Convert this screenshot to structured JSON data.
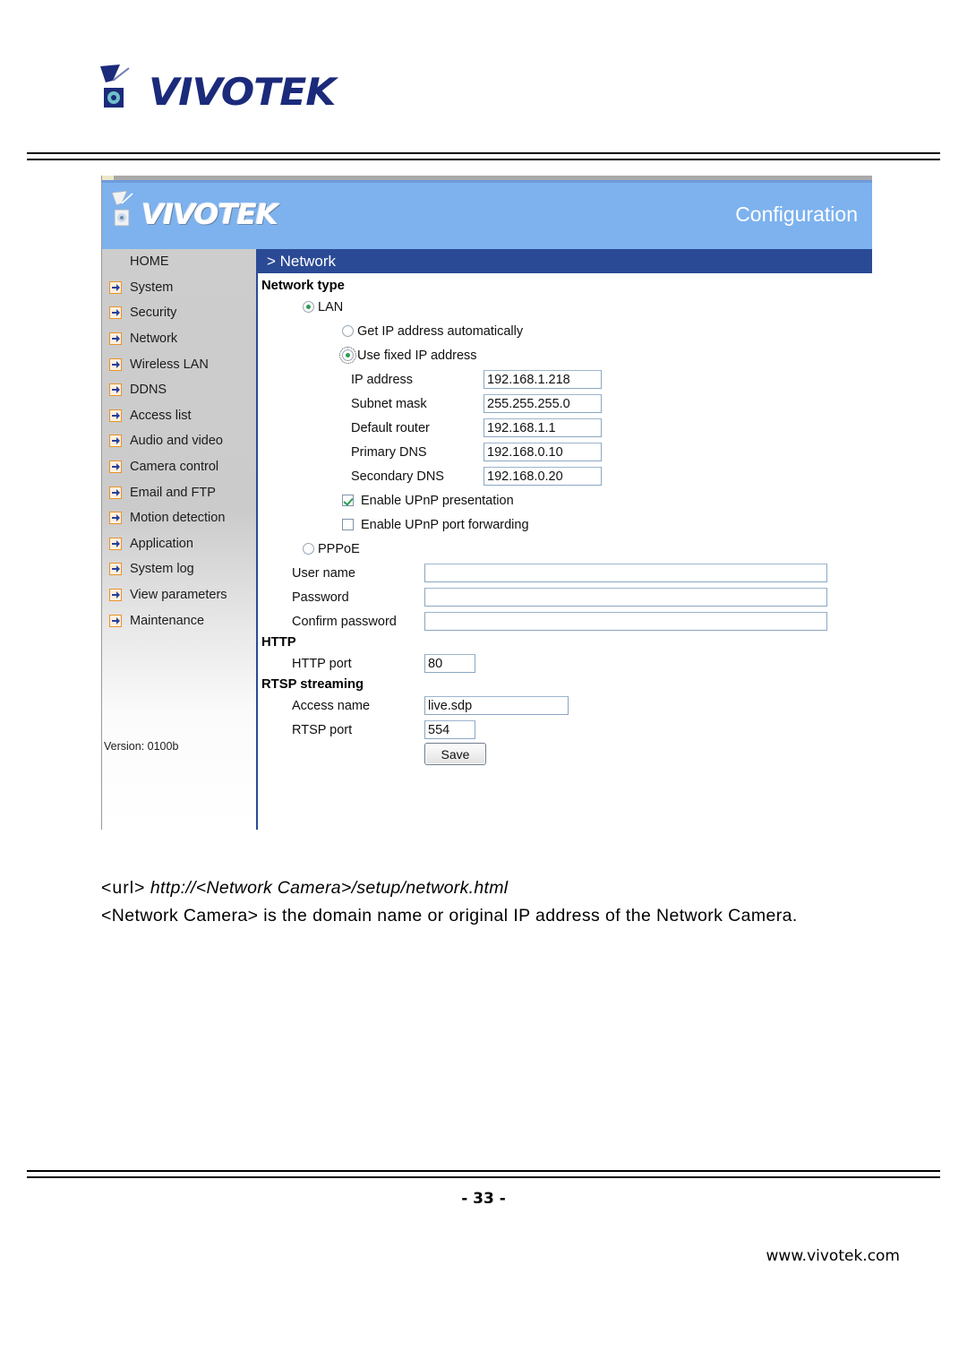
{
  "document": {
    "brand": "VIVOTEK",
    "page_number": "- 33 -",
    "website": "www.vivotek.com",
    "caption_url_tag": "<url>",
    "caption_url_value": "http://<Network Camera>/setup/network.html",
    "caption_note": "<Network Camera> is the domain name or original IP address of the Network Camera."
  },
  "screenshot": {
    "header": {
      "brand": "VIVOTEK",
      "section": "Configuration"
    },
    "breadcrumb": "> Network",
    "sidebar": {
      "items": [
        {
          "label": "HOME",
          "has_icon": false
        },
        {
          "label": "System",
          "has_icon": true
        },
        {
          "label": "Security",
          "has_icon": true
        },
        {
          "label": "Network",
          "has_icon": true
        },
        {
          "label": "Wireless LAN",
          "has_icon": true
        },
        {
          "label": "DDNS",
          "has_icon": true
        },
        {
          "label": "Access list",
          "has_icon": true
        },
        {
          "label": "Audio and video",
          "has_icon": true
        },
        {
          "label": "Camera control",
          "has_icon": true
        },
        {
          "label": "Email and FTP",
          "has_icon": true
        },
        {
          "label": "Motion detection",
          "has_icon": true
        },
        {
          "label": "Application",
          "has_icon": true
        },
        {
          "label": "System log",
          "has_icon": true
        },
        {
          "label": "View parameters",
          "has_icon": true
        },
        {
          "label": "Maintenance",
          "has_icon": true
        }
      ],
      "version": "Version: 0100b"
    },
    "form": {
      "network_type_heading": "Network type",
      "lan_label": "LAN",
      "lan_selected": true,
      "get_ip_auto_label": "Get IP address automatically",
      "get_ip_auto_selected": false,
      "use_fixed_label": "Use fixed IP address",
      "use_fixed_selected": true,
      "fields": [
        {
          "label": "IP address",
          "value": "192.168.1.218"
        },
        {
          "label": "Subnet mask",
          "value": "255.255.255.0"
        },
        {
          "label": "Default router",
          "value": "192.168.1.1"
        },
        {
          "label": "Primary DNS",
          "value": "192.168.0.10"
        },
        {
          "label": "Secondary DNS",
          "value": "192.168.0.20"
        }
      ],
      "upnp_presentation_label": "Enable UPnP presentation",
      "upnp_presentation_checked": true,
      "upnp_forwarding_label": "Enable UPnP port forwarding",
      "upnp_forwarding_checked": false,
      "pppoe_label": "PPPoE",
      "pppoe_selected": false,
      "pppoe_fields": [
        {
          "label": "User name",
          "value": ""
        },
        {
          "label": "Password",
          "value": ""
        },
        {
          "label": "Confirm password",
          "value": ""
        }
      ],
      "http_heading": "HTTP",
      "http_port_label": "HTTP port",
      "http_port_value": "80",
      "rtsp_heading": "RTSP streaming",
      "access_name_label": "Access name",
      "access_name_value": "live.sdp",
      "rtsp_port_label": "RTSP port",
      "rtsp_port_value": "554",
      "save_label": "Save"
    },
    "colors": {
      "banner_blue": "#7db2ee",
      "bar_dark_blue": "#2b4a95",
      "sidebar_gray": "#cdcdcd",
      "icon_orange": "#e8922a",
      "check_green": "#2f9c4f"
    }
  }
}
